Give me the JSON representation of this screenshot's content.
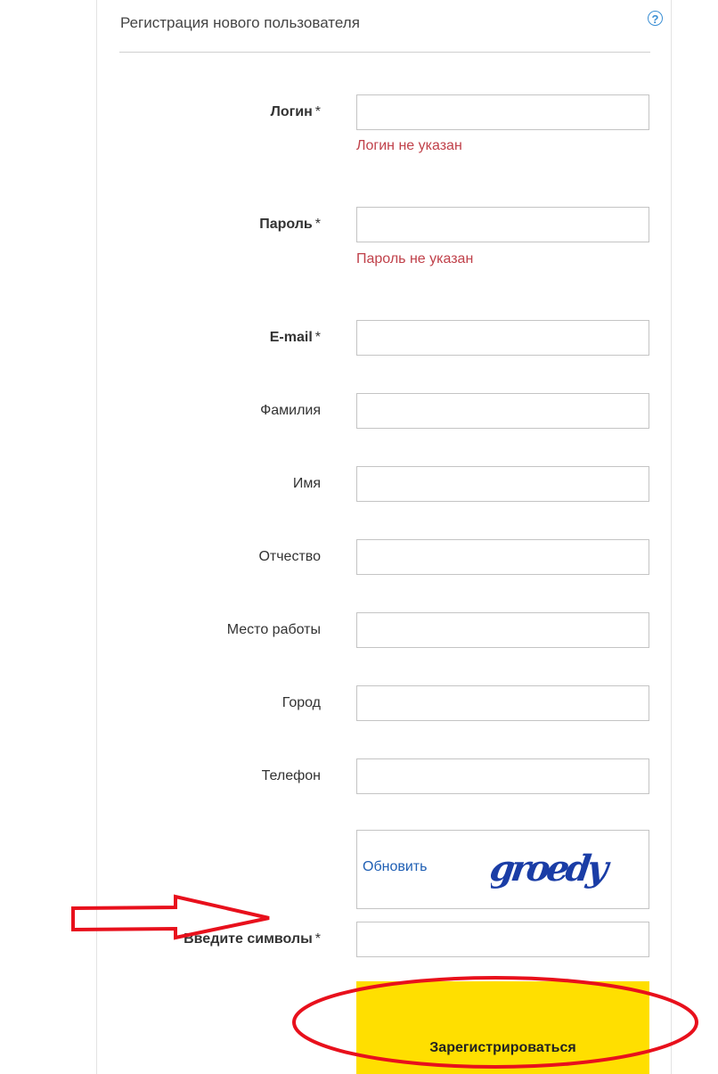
{
  "form": {
    "title": "Регистрация нового пользователя",
    "help_icon": "help-circle-icon",
    "required_marker": "*",
    "fields": {
      "login": {
        "label": "Логин",
        "value": "",
        "error": "Логин не указан"
      },
      "password": {
        "label": "Пароль",
        "value": "",
        "error": "Пароль не указан"
      },
      "email": {
        "label": "E-mail",
        "value": ""
      },
      "last_name": {
        "label": "Фамилия",
        "value": ""
      },
      "first_name": {
        "label": "Имя",
        "value": ""
      },
      "patronymic": {
        "label": "Отчество",
        "value": ""
      },
      "workplace": {
        "label": "Место работы",
        "value": ""
      },
      "city": {
        "label": "Город",
        "value": ""
      },
      "phone": {
        "label": "Телефон",
        "value": ""
      },
      "captcha": {
        "label": "Введите символы",
        "value": ""
      }
    },
    "captcha": {
      "refresh_label": "Обновить",
      "image_text": "groedy"
    },
    "submit_label": "Зарегистрироваться"
  },
  "colors": {
    "error": "#c0414a",
    "link": "#1f5fb4",
    "submit_bg": "#ffdf00",
    "annotation": "#e8101c",
    "help_icon": "#3b8fd4"
  }
}
